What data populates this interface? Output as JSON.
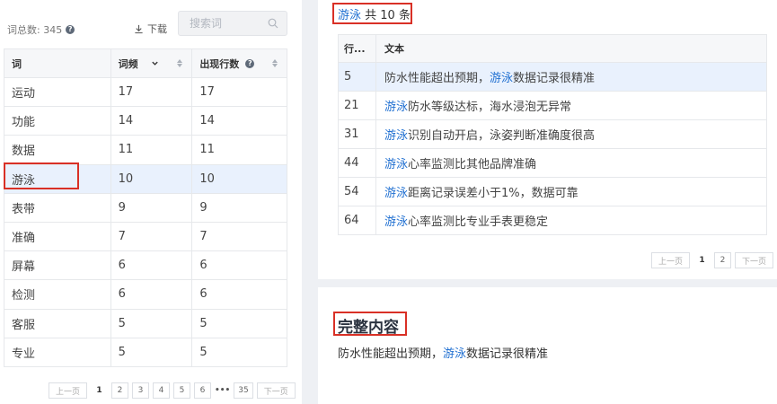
{
  "left": {
    "total_label": "词总数: 345",
    "download_label": "下载",
    "search_placeholder": "搜索词",
    "headers": {
      "word": "词",
      "freq": "词频",
      "lines": "出现行数"
    },
    "rows": [
      {
        "word": "运动",
        "freq": "17",
        "lines": "17"
      },
      {
        "word": "功能",
        "freq": "14",
        "lines": "14"
      },
      {
        "word": "数据",
        "freq": "11",
        "lines": "11"
      },
      {
        "word": "游泳",
        "freq": "10",
        "lines": "10"
      },
      {
        "word": "表带",
        "freq": "9",
        "lines": "9"
      },
      {
        "word": "准确",
        "freq": "7",
        "lines": "7"
      },
      {
        "word": "屏幕",
        "freq": "6",
        "lines": "6"
      },
      {
        "word": "检测",
        "freq": "6",
        "lines": "6"
      },
      {
        "word": "客服",
        "freq": "5",
        "lines": "5"
      },
      {
        "word": "专业",
        "freq": "5",
        "lines": "5"
      }
    ],
    "selected_row": 3,
    "pager": {
      "prev": "上一页",
      "pages": [
        "1",
        "2",
        "3",
        "4",
        "5",
        "6"
      ],
      "ellipsis": "•••",
      "last": "35",
      "next": "下一页",
      "current": "1"
    }
  },
  "detail": {
    "keyword": "游泳",
    "count_text": " 共 10 条",
    "headers": {
      "line": "行...",
      "text": "文本"
    },
    "rows": [
      {
        "line": "5",
        "pre": "防水性能超出预期，",
        "kw": "游泳",
        "post": "数据记录很精准"
      },
      {
        "line": "21",
        "pre": "",
        "kw": "游泳",
        "post": "防水等级达标，海水浸泡无异常"
      },
      {
        "line": "31",
        "pre": "",
        "kw": "游泳",
        "post": "识别自动开启，泳姿判断准确度很高"
      },
      {
        "line": "44",
        "pre": "",
        "kw": "游泳",
        "post": "心率监测比其他品牌准确"
      },
      {
        "line": "54",
        "pre": "",
        "kw": "游泳",
        "post": "距离记录误差小于1%，数据可靠"
      },
      {
        "line": "64",
        "pre": "",
        "kw": "游泳",
        "post": "心率监测比专业手表更稳定"
      }
    ],
    "selected_row": 0,
    "pager": {
      "prev": "上一页",
      "pages": [
        "1",
        "2"
      ],
      "next": "下一页",
      "current": "1"
    }
  },
  "full": {
    "title": "完整内容",
    "pre": "防水性能超出预期，",
    "kw": "游泳",
    "post": "数据记录很精准"
  },
  "colors": {
    "keyword": "#1f6fd1",
    "highlight_box": "#d93026",
    "selected_row": "#e9f1fd"
  }
}
